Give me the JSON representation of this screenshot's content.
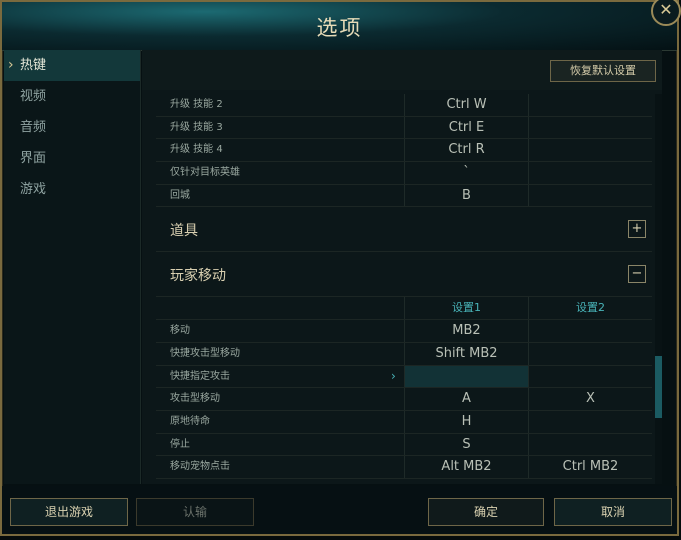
{
  "dialog": {
    "title": "选项",
    "close_label": "✕"
  },
  "sidebar": {
    "items": [
      {
        "label": "热键",
        "active": true
      },
      {
        "label": "视频",
        "active": false
      },
      {
        "label": "音频",
        "active": false
      },
      {
        "label": "界面",
        "active": false
      },
      {
        "label": "游戏",
        "active": false
      }
    ]
  },
  "toolbar": {
    "reset_label": "恢复默认设置"
  },
  "keybinds": {
    "top_rows": [
      {
        "action": "升级 技能 2",
        "key1": "Ctrl W",
        "key2": ""
      },
      {
        "action": "升级 技能 3",
        "key1": "Ctrl E",
        "key2": ""
      },
      {
        "action": "升级 技能 4",
        "key1": "Ctrl R",
        "key2": ""
      },
      {
        "action": "仅针对目标英雄",
        "key1": "`",
        "key2": ""
      },
      {
        "action": "回城",
        "key1": "B",
        "key2": ""
      }
    ],
    "sections": {
      "items": {
        "label": "道具",
        "toggle": "+"
      },
      "movement": {
        "label": "玩家移动",
        "toggle": "−"
      }
    },
    "headers": {
      "set1": "设置1",
      "set2": "设置2"
    },
    "movement_rows": [
      {
        "action": "移动",
        "key1": "MB2",
        "key2": ""
      },
      {
        "action": "快捷攻击型移动",
        "key1": "Shift MB2",
        "key2": ""
      },
      {
        "action": "快捷指定攻击",
        "key1": "",
        "key2": ""
      },
      {
        "action": "攻击型移动",
        "key1": "A",
        "key2": "X"
      },
      {
        "action": "原地待命",
        "key1": "H",
        "key2": ""
      },
      {
        "action": "停止",
        "key1": "S",
        "key2": ""
      },
      {
        "action": "移动宠物点击",
        "key1": "Alt MB2",
        "key2": "Ctrl MB2"
      }
    ]
  },
  "footer": {
    "exit": "退出游戏",
    "confirm": "认输",
    "ok": "确定",
    "cancel": "取消"
  },
  "colors": {
    "accent": "#49b4b9",
    "gold": "#7a6a3e"
  }
}
